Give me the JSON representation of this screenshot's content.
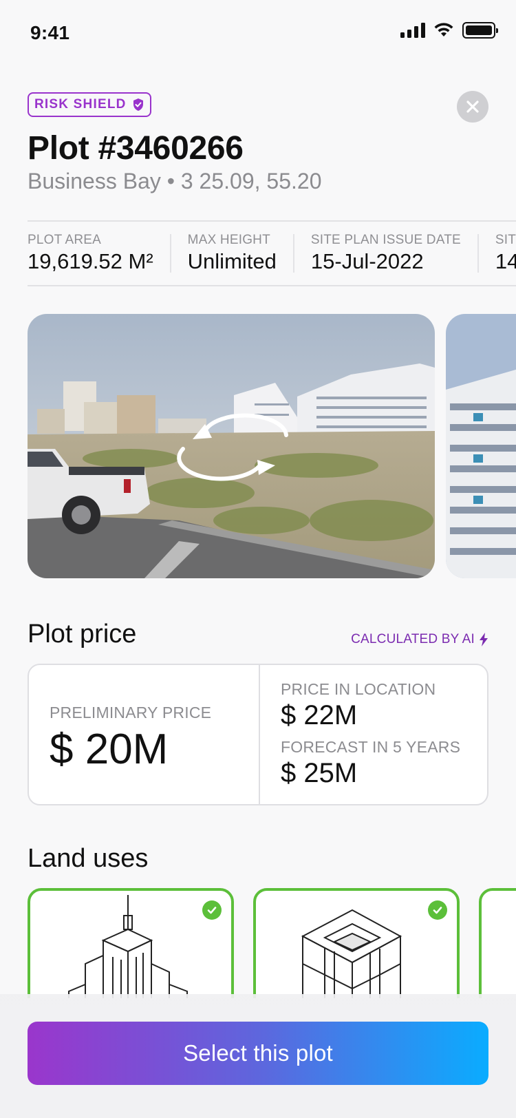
{
  "status_bar": {
    "time": "9:41"
  },
  "header": {
    "badge": "RISK SHIELD",
    "title": "Plot #3460266",
    "subtitle": "Business Bay • 3 25.09, 55.20"
  },
  "stats": [
    {
      "label": "PLOT AREA",
      "value": "19,619.52 M²"
    },
    {
      "label": "MAX HEIGHT",
      "value": "Unlimited"
    },
    {
      "label": "SITE PLAN ISSUE DATE",
      "value": "15-Jul-2022"
    },
    {
      "label": "SIT",
      "value": "14"
    }
  ],
  "price": {
    "section_title": "Plot price",
    "ai_tag": "CALCULATED BY AI",
    "preliminary_label": "PRELIMINARY PRICE",
    "preliminary_value": "$ 20M",
    "location_label": "PRICE IN LOCATION",
    "location_value": "$ 22M",
    "forecast_label": "FORECAST IN 5 YEARS",
    "forecast_value": "$ 25M"
  },
  "land_uses": {
    "section_title": "Land uses"
  },
  "cta": {
    "label": "Select this plot"
  },
  "colors": {
    "accent_purple": "#9933cc",
    "check_green": "#5cbf3a",
    "cta_start": "#9a36cc",
    "cta_end": "#0aacff"
  },
  "icons": [
    "shield-check-icon",
    "close-icon",
    "rotate-360-icon",
    "lightning-icon",
    "check-icon",
    "skyscraper-icon",
    "building-icon"
  ]
}
